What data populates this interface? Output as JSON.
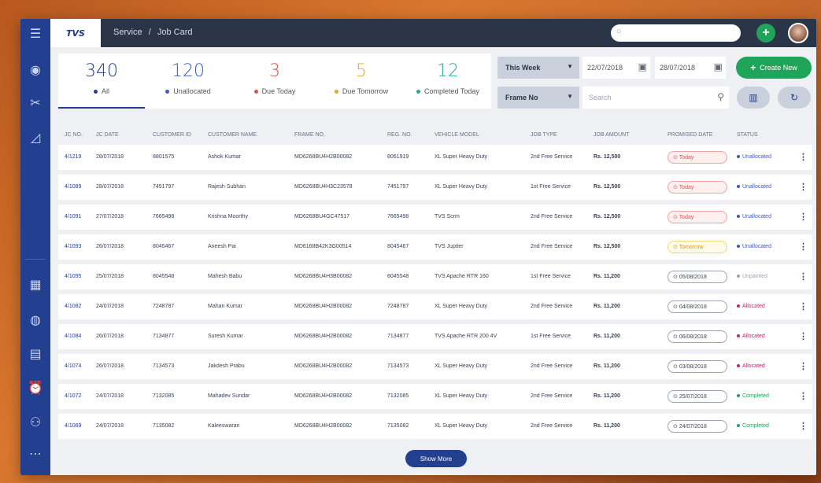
{
  "topbar": {
    "logo": "TVS",
    "breadcrumb": [
      "Service",
      "/",
      "Job Card"
    ],
    "search_placeholder": "",
    "add_label": "+"
  },
  "stats": [
    {
      "value": "340",
      "label": "All",
      "color": "#233f8f",
      "active": true
    },
    {
      "value": "120",
      "label": "Unallocated",
      "color": "#3b5bc4"
    },
    {
      "value": "3",
      "label": "Due Today",
      "color": "#d9534f"
    },
    {
      "value": "5",
      "label": "Due Tomorrow",
      "color": "#e0a92b"
    },
    {
      "value": "12",
      "label": "Completed Today",
      "color": "#2aa79b"
    }
  ],
  "filters": {
    "period": "This Week",
    "date_from": "22/07/2018",
    "date_to": "28/07/2018",
    "frame": "Frame No",
    "search_placeholder": "Search",
    "create_label": "Create New"
  },
  "table": {
    "headers": [
      "JC NO.",
      "JC DATE",
      "CUSTOMER ID",
      "CUSTOMER NAME",
      "FRAME NO.",
      "REG. NO.",
      "VEHICLE MODEL",
      "JOB TYPE",
      "JOB AMOUNT",
      "PROMISED DATE",
      "STATUS"
    ],
    "rows": [
      {
        "jc": "4/1219",
        "date": "28/07/2018",
        "cid": "8801575",
        "name": "Ashok Kumar",
        "frame": "MD6268BU4H2B00082",
        "reg": "8061919",
        "model": "XL Super Heavy Duty",
        "type": "2nd Free Service",
        "amount": "Rs. 12,500",
        "promise": "Today",
        "ptype": "today",
        "status": "Unallocated",
        "scolor": "#3b5bc4"
      },
      {
        "jc": "4/1089",
        "date": "28/07/2018",
        "cid": "7451797",
        "name": "Rajesh Subhan",
        "frame": "MD6268BU4H3C23578",
        "reg": "7451797",
        "model": "XL Super Heavy Duty",
        "type": "1st Free Service",
        "amount": "Rs. 12,500",
        "promise": "Today",
        "ptype": "today",
        "status": "Unallocated",
        "scolor": "#3b5bc4"
      },
      {
        "jc": "4/1091",
        "date": "27/07/2018",
        "cid": "7665498",
        "name": "Krishna Moorthy",
        "frame": "MD6268BU4GC47517",
        "reg": "7665498",
        "model": "TVS Scrm",
        "type": "2nd Free Service",
        "amount": "Rs. 12,500",
        "promise": "Today",
        "ptype": "today",
        "status": "Unallocated",
        "scolor": "#3b5bc4"
      },
      {
        "jc": "4/1093",
        "date": "26/07/2018",
        "cid": "8045467",
        "name": "Aneesh Pai",
        "frame": "MD6168B42K3G00514",
        "reg": "8045467",
        "model": "TVS Jupiter",
        "type": "2nd Free Service",
        "amount": "Rs. 12,500",
        "promise": "Tomorrow",
        "ptype": "tomorrow",
        "status": "Unallocated",
        "scolor": "#3b5bc4"
      },
      {
        "jc": "4/1095",
        "date": "25/07/2018",
        "cid": "8045548",
        "name": "Mahesh Babu",
        "frame": "MD6268BU4H3B00082",
        "reg": "8045548",
        "model": "TVS Apache RTR 160",
        "type": "1st Free Service",
        "amount": "Rs. 11,200",
        "promise": "05/08/2018",
        "ptype": "date",
        "status": "Unpainted",
        "scolor": "#9aa3b5"
      },
      {
        "jc": "4/1082",
        "date": "24/07/2018",
        "cid": "7248787",
        "name": "Mahan Kumar",
        "frame": "MD6268BU4H2B00082",
        "reg": "7248787",
        "model": "XL Super Heavy Duty",
        "type": "2nd Free Service",
        "amount": "Rs. 11,200",
        "promise": "04/08/2018",
        "ptype": "date",
        "status": "Allocated",
        "scolor": "#c2237a"
      },
      {
        "jc": "4/1084",
        "date": "26/07/2018",
        "cid": "7134877",
        "name": "Suresh Kumar",
        "frame": "MD6268BU4H2B00082",
        "reg": "7134877",
        "model": "TVS Apache RTR 200 4V",
        "type": "1st Free Service",
        "amount": "Rs. 11,200",
        "promise": "06/08/2018",
        "ptype": "date",
        "status": "Allocated",
        "scolor": "#c2237a"
      },
      {
        "jc": "4/1074",
        "date": "26/07/2018",
        "cid": "7134573",
        "name": "Jakdesh Prabu",
        "frame": "MD6268BU4H2B00082",
        "reg": "7134573",
        "model": "XL Super Heavy Duty",
        "type": "2nd Free Service",
        "amount": "Rs. 11,200",
        "promise": "03/08/2018",
        "ptype": "date",
        "status": "Allocated",
        "scolor": "#c2237a"
      },
      {
        "jc": "4/1072",
        "date": "24/07/2018",
        "cid": "7132085",
        "name": "Mahadev Sundar",
        "frame": "MD6268BU4H2B00082",
        "reg": "7132085",
        "model": "XL Super Heavy Duty",
        "type": "2nd Free Service",
        "amount": "Rs. 11,200",
        "promise": "25/07/2018",
        "ptype": "date",
        "status": "Completed",
        "scolor": "#1ea55a"
      },
      {
        "jc": "4/1069",
        "date": "24/07/2018",
        "cid": "7135082",
        "name": "Kaleeswaran",
        "frame": "MD6268BU4H2B00082",
        "reg": "7135082",
        "model": "XL Super Heavy Duty",
        "type": "2nd Free Service",
        "amount": "Rs. 11,200",
        "promise": "24/07/2018",
        "ptype": "date",
        "status": "Completed",
        "scolor": "#1ea55a"
      }
    ]
  },
  "show_more_label": "Show More"
}
